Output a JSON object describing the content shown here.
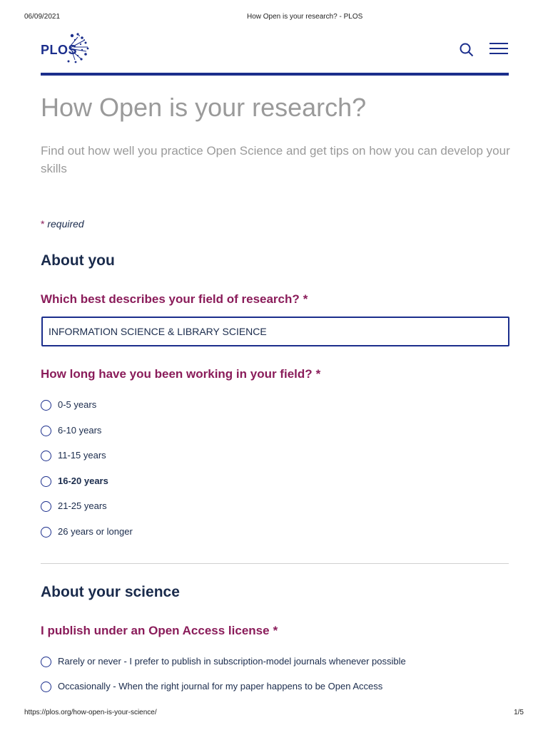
{
  "print": {
    "date": "06/09/2021",
    "title": "How Open is your research? - PLOS",
    "url": "https://plos.org/how-open-is-your-science/",
    "page": "1/5"
  },
  "header": {
    "logo_text": "PLOS",
    "search_icon": "search-icon",
    "menu_icon": "hamburger-menu-icon",
    "brand_color": "#1b2e8c"
  },
  "page": {
    "title": "How Open is your research?",
    "subtitle": "Find out how well you practice Open Science and get tips on how you can develop your skills",
    "required_star": "*",
    "required_text": "required"
  },
  "sections": {
    "about_you": {
      "heading": "About you",
      "field_question": "Which best describes your field of research?",
      "field_value": "INFORMATION SCIENCE & LIBRARY SCIENCE",
      "duration_question": "How long have you been working in your field?",
      "duration_options": [
        "0-5 years",
        "6-10 years",
        "11-15 years",
        "16-20 years",
        "21-25 years",
        "26 years or longer"
      ]
    },
    "about_science": {
      "heading": "About your science",
      "oa_question": "I publish under an Open Access license",
      "oa_options": [
        "Rarely or never - I prefer to publish in subscription-model journals whenever possible",
        "Occasionally - When the right journal for my paper happens to be Open Access"
      ]
    }
  },
  "question_star": "*",
  "accent_color": "#8a1c5a"
}
